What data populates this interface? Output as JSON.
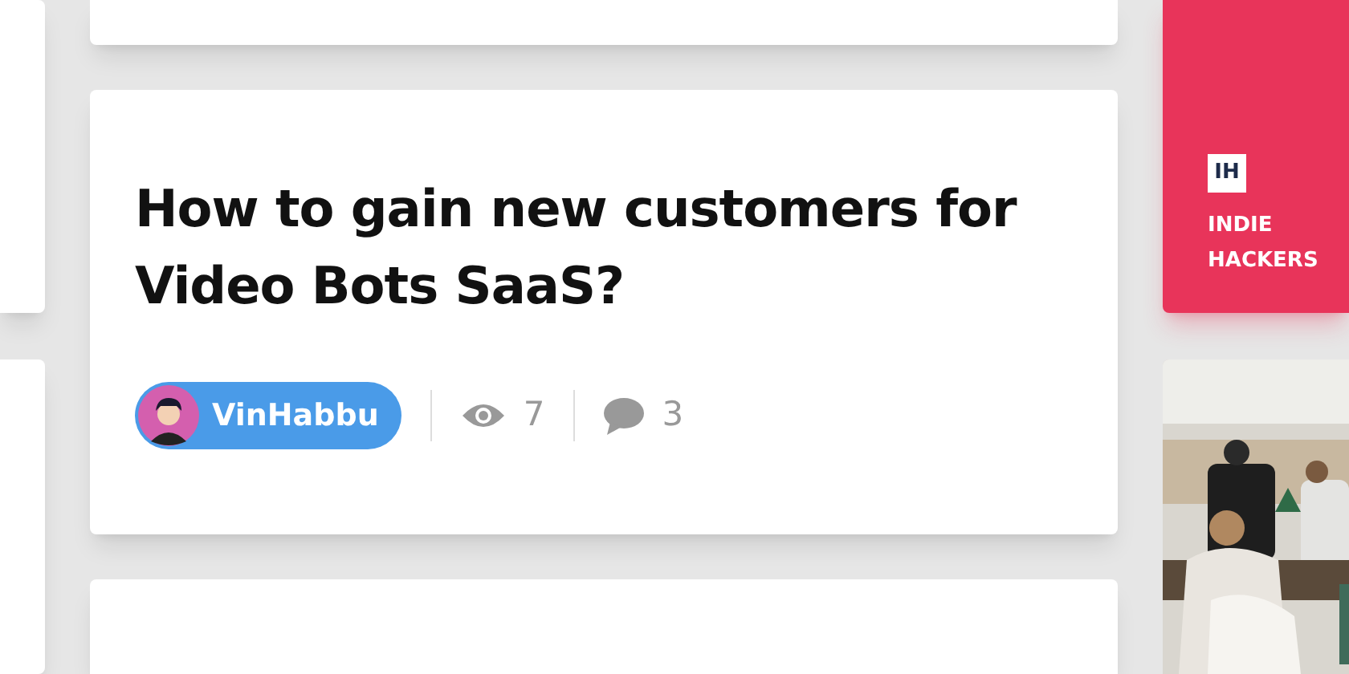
{
  "post": {
    "title": "How to gain new customers for Video Bots SaaS?",
    "author": "VinHabbu",
    "views": "7",
    "comments": "3"
  },
  "sidebar": {
    "logo_text": "IH",
    "brand": "INDIE HACKERS"
  }
}
